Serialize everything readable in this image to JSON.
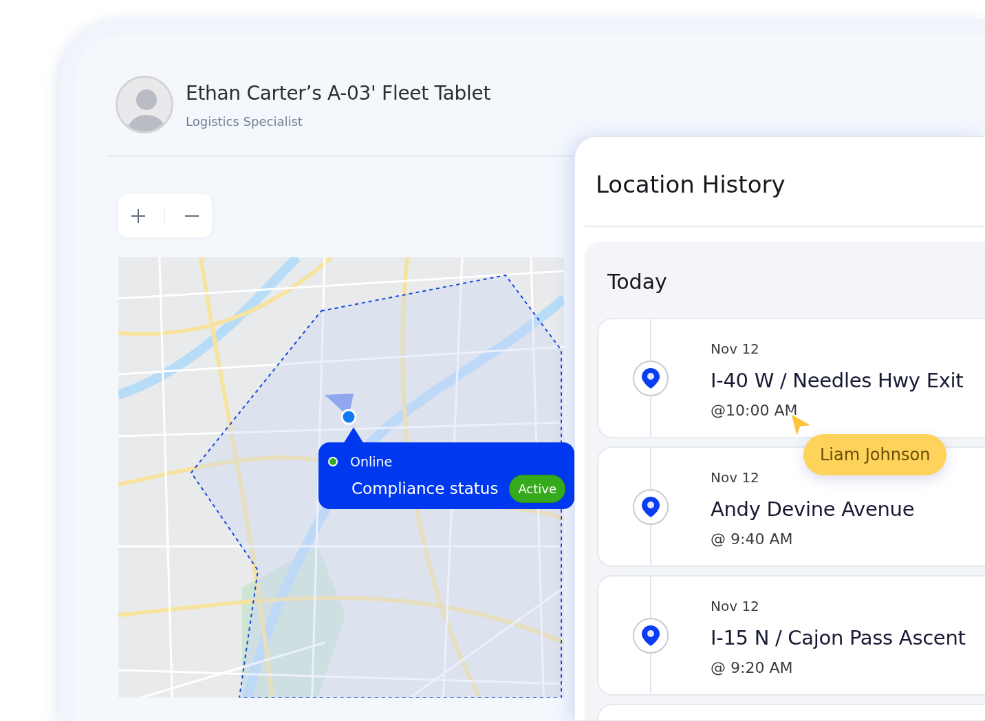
{
  "device": {
    "title": "Ethan Carter’s A-03' Fleet Tablet",
    "subtitle": "Logistics Specialist"
  },
  "map": {
    "tooltip": {
      "status": "Online",
      "label": "Compliance status",
      "badge": "Active"
    }
  },
  "location_history": {
    "title": "Location History",
    "section": "Today",
    "entries": [
      {
        "date": "Nov 12",
        "place": "I-40 W / Needles Hwy Exit",
        "time": "@10:00 AM"
      },
      {
        "date": "Nov 12",
        "place": "Andy Devine Avenue",
        "time": "@ 9:40 AM"
      },
      {
        "date": "Nov 12",
        "place": "I-15 N / Cajon Pass Ascent",
        "time": "@ 9:20 AM"
      }
    ]
  },
  "cursor": {
    "label": "Liam Johnson"
  }
}
